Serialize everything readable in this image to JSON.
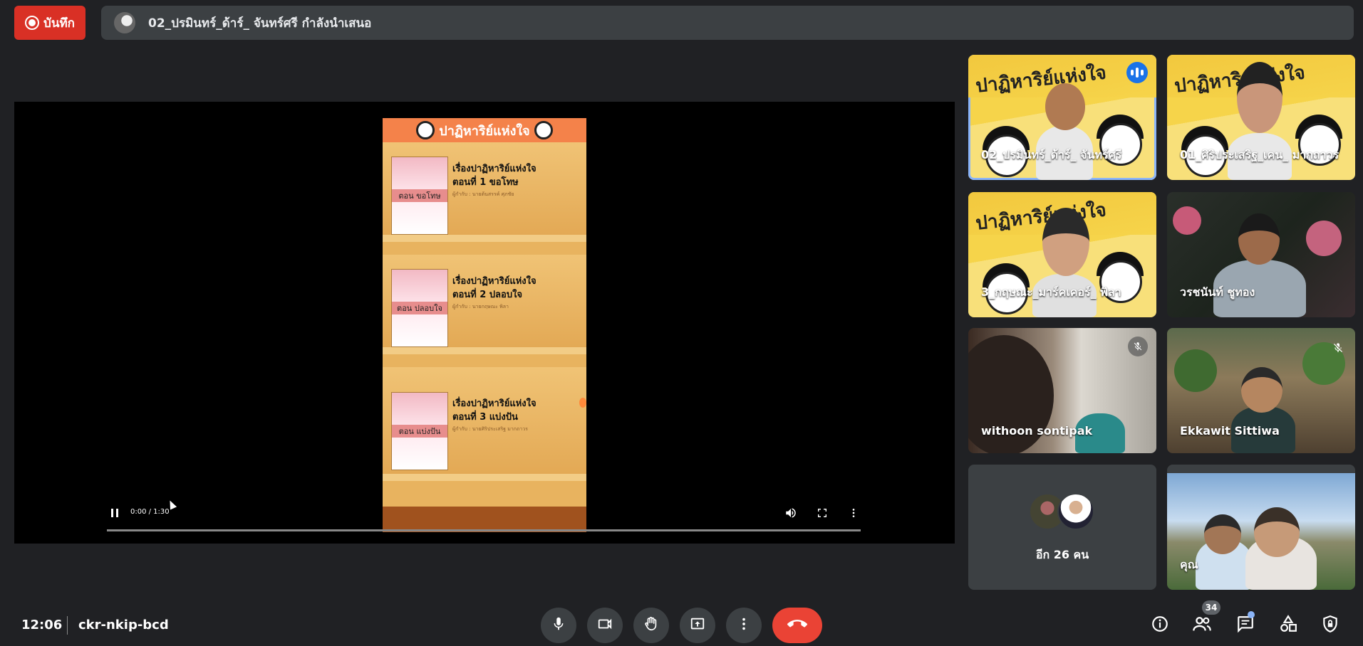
{
  "recording": {
    "label": "บันทึก"
  },
  "presenter": {
    "text": "02_ปรมินทร์_ด้าร์_ จันทร์ศรี กำลังนำเสนอ"
  },
  "slide": {
    "banner": "ปาฏิหาริย์แห่งใจ",
    "episodes": [
      {
        "title1": "เรื่องปาฏิหาริย์แห่งใจ",
        "title2": "ตอนที่ 1 ขอโทษ",
        "tag": "ตอน ขอโทษ",
        "credit": "ผู้กำกับ : นายต้นสรรค์ ศุภชัย"
      },
      {
        "title1": "เรื่องปาฏิหาริย์แห่งใจ",
        "title2": "ตอนที่ 2 ปลอบใจ",
        "tag": "ตอน ปลอบใจ",
        "credit": "ผู้กำกับ : นายกฤษณะ พิลา"
      },
      {
        "title1": "เรื่องปาฏิหาริย์แห่งใจ",
        "title2": "ตอนที่ 3 แบ่งปัน",
        "tag": "ตอน แบ่งปัน",
        "credit": "ผู้กำกับ : นายศิริประเสริฐ มากถาวร"
      }
    ]
  },
  "video": {
    "time": "0:00 / 1:30",
    "progress": 0.0
  },
  "participants": [
    {
      "name": "02_ปรมินทร์_ด้าร์_ จันทร์ศรี",
      "status": "speaking"
    },
    {
      "name": "01_ศิริประเสริฐ_เคน_ มากถาวร",
      "status": ""
    },
    {
      "name": "3_กฤษณะ_มาร์คเคอร์_ พิลา",
      "status": ""
    },
    {
      "name": "วรชนันท์ ชูทอง",
      "status": ""
    },
    {
      "name": "withoon sontipak",
      "status": "muted"
    },
    {
      "name": "Ekkawit Sittiwa",
      "status": "muted"
    },
    {
      "name": "คุณ",
      "status": ""
    }
  ],
  "tile_title": "ปาฏิหาริย์แห่งใจ",
  "more_participants": {
    "label": "อีก 26 คน"
  },
  "bottom": {
    "clock": "12:06",
    "meeting_code": "ckr-nkip-bcd",
    "people_count": "34"
  },
  "colors": {
    "accent": "#8ab4f8",
    "danger": "#ea4335",
    "record": "#d93025",
    "surface": "#3c4043",
    "background": "#202124"
  }
}
